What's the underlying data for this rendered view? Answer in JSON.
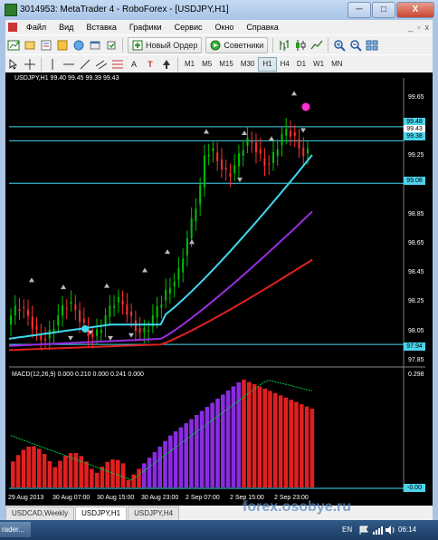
{
  "window": {
    "title": "3014953: MetaTrader 4 - RoboForex - [USDJPY,H1]",
    "minimize_glyph": "─",
    "maximize_glyph": "□",
    "close_glyph": "X"
  },
  "menu": {
    "items": [
      "Файл",
      "Вид",
      "Вставка",
      "Графики",
      "Сервис",
      "Окно",
      "Справка"
    ],
    "window_controls": [
      "_",
      "▫",
      "x"
    ]
  },
  "toolbar": {
    "new_order_label": "Новый Ордер",
    "advisors_label": "Советники",
    "timeframes": [
      "M1",
      "M5",
      "M15",
      "M30",
      "H1",
      "H4",
      "D1",
      "W1",
      "MN"
    ],
    "active_timeframe": "H1",
    "draw_tools": [
      "A",
      "T"
    ]
  },
  "chart": {
    "header": "USDJPY,H1  99.40 99.45 99.39 99.43",
    "price_labels": [
      "99.65",
      "99.25",
      "98.85",
      "98.65",
      "98.45",
      "98.25",
      "98.05",
      "97.85"
    ],
    "price_boxes": [
      {
        "label": "99.48",
        "color": "#4dd4ec"
      },
      {
        "label": "99.43",
        "color": "#ffffff"
      },
      {
        "label": "99.38",
        "color": "#4dd4ec"
      },
      {
        "label": "99.08",
        "color": "#4dd4ec"
      },
      {
        "label": "97.94",
        "color": "#4dd4ec"
      }
    ],
    "time_labels": [
      "29 Aug 2013",
      "30 Aug 07:00",
      "30 Aug 15:00",
      "30 Aug 23:00",
      "2 Sep 07:00",
      "2 Sep 15:00",
      "2 Sep 23:00"
    ],
    "bull_color": "#00c000",
    "bear_color": "#ff3030",
    "ma_colors": [
      "#40d8f0",
      "#9a2de0",
      "#e02020"
    ],
    "hline_color": "#40d8f0",
    "marker_colors": [
      "#ff30d0",
      "#40d8f0"
    ]
  },
  "macd": {
    "header": "MACD(12,26,9)  0.000 0.210 0.000 0.241 0.000",
    "scale_top": "0.298",
    "scale_bottom": "-0.00",
    "colors": {
      "down": "#e02020",
      "up": "#8a2be2",
      "signal": "#00cc44"
    }
  },
  "tabs": [
    "USDCAD,Weekly",
    "USDJPY,H1",
    "USDJPY,H4"
  ],
  "active_tab": "USDJPY,H1",
  "taskbar": {
    "app_label": "rader...",
    "lang": "EN",
    "clock": "06:14"
  },
  "watermark": "forex.osobye.ru"
}
